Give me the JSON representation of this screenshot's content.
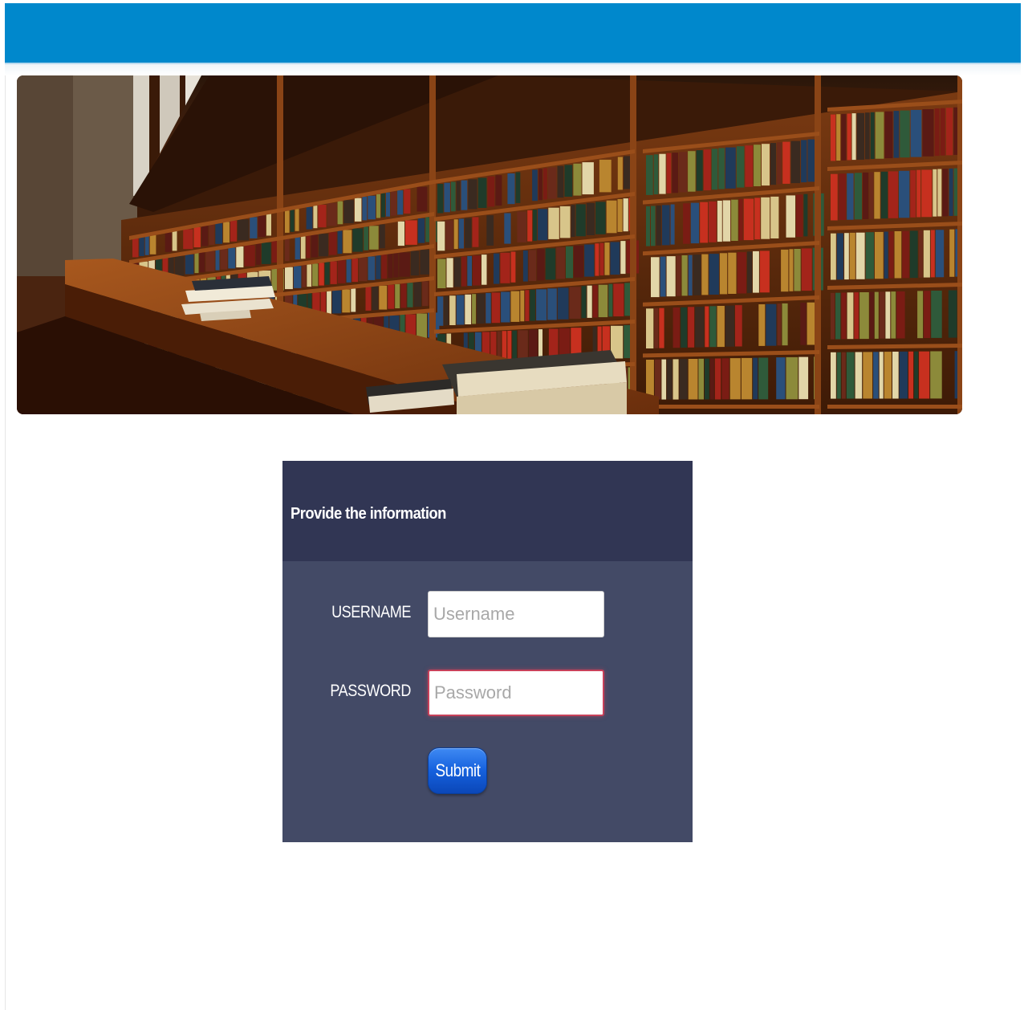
{
  "colors": {
    "header_bar": "#0088cc",
    "panel_header": "#313654",
    "panel_body": "#434a66",
    "button": "#1560dd",
    "focus_ring": "#c8415a"
  },
  "banner": {
    "image": "library-bookshelves-photo"
  },
  "login_panel": {
    "title": "Provide the information",
    "username": {
      "label": "USERNAME",
      "value": "",
      "placeholder": "Username"
    },
    "password": {
      "label": "PASSWORD",
      "value": "",
      "placeholder": "Password"
    },
    "submit_label": "Submit"
  }
}
